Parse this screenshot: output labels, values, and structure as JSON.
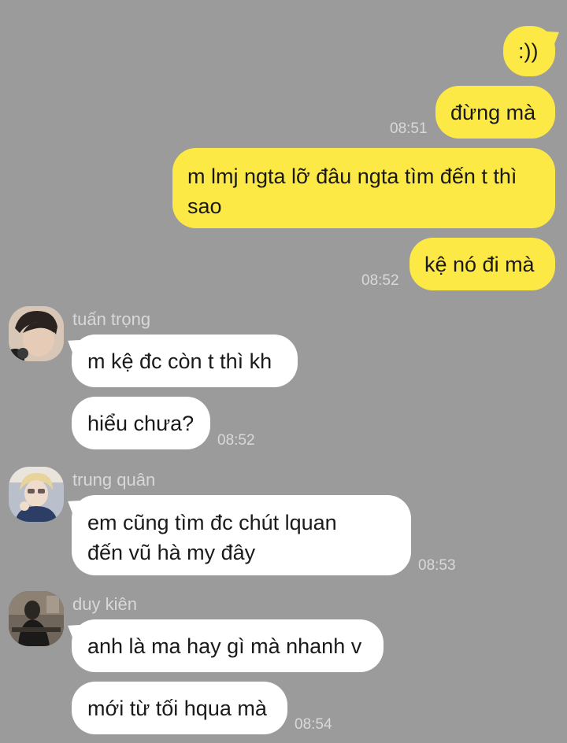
{
  "messages_out": [
    {
      "text": ":))"
    },
    {
      "text": "đừng mà",
      "time": "08:51"
    },
    {
      "text": "m lmj ngta lỡ đâu ngta tìm đến t thì sao",
      "line1": "m lmj ngta lỡ đâu ngta tìm đến t thì",
      "line2": "sao"
    },
    {
      "text": "kệ nó đi mà",
      "time": "08:52"
    }
  ],
  "group1": {
    "sender": "tuấn trọng",
    "messages": [
      {
        "text": "m kệ đc còn t thì kh"
      },
      {
        "text": "hiểu chưa?",
        "time": "08:52"
      }
    ]
  },
  "group2": {
    "sender": "trung quân",
    "messages": [
      {
        "line1": "em cũng tìm đc chút lquan",
        "line2": "đến vũ hà my đây",
        "time": "08:53"
      }
    ]
  },
  "group3": {
    "sender": "duy kiên",
    "messages": [
      {
        "text": "anh là ma hay gì mà nhanh v"
      },
      {
        "text": "mới từ tối hqua mà",
        "time": "08:54"
      }
    ]
  },
  "colors": {
    "background": "#9b9b9b",
    "outgoing_bubble": "#fce945",
    "incoming_bubble": "#ffffff"
  }
}
